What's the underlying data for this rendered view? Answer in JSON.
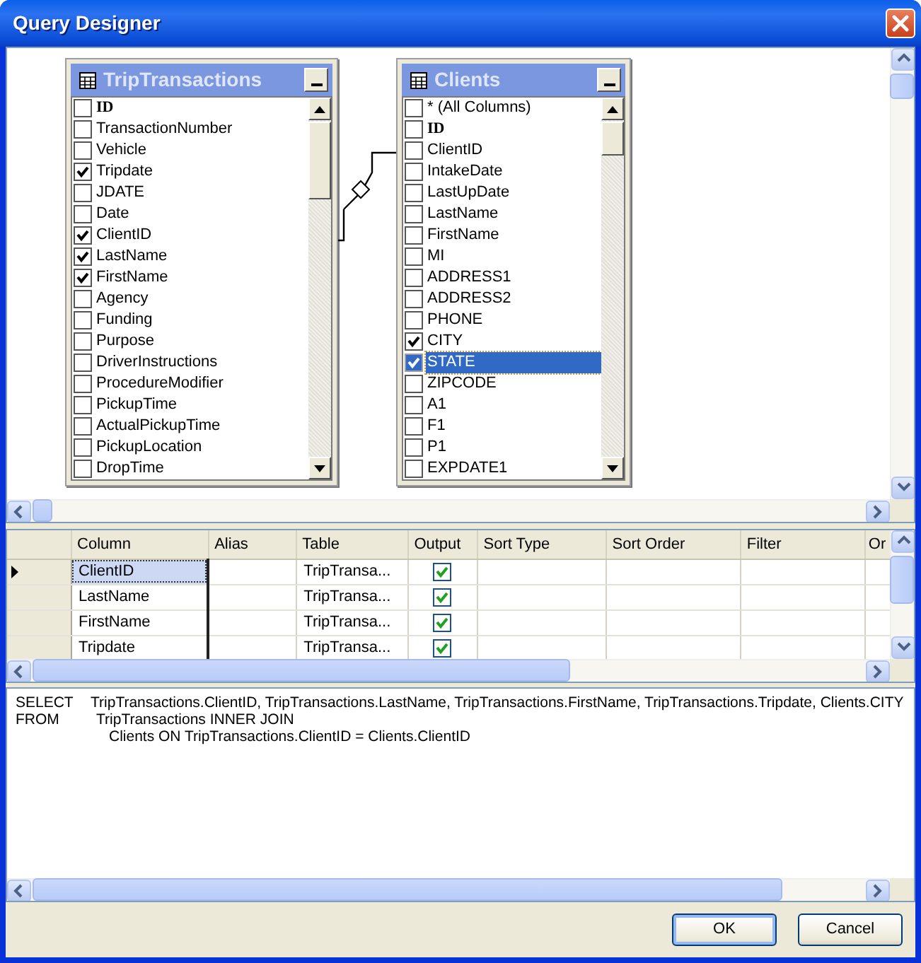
{
  "window": {
    "title": "Query Designer"
  },
  "diagram": {
    "tables": [
      {
        "title": "TripTransactions",
        "items": [
          {
            "label": "ID",
            "kind": "key",
            "checked": false,
            "selected": false
          },
          {
            "label": "TransactionNumber",
            "kind": "column",
            "checked": false,
            "selected": false
          },
          {
            "label": "Vehicle",
            "kind": "column",
            "checked": false,
            "selected": false
          },
          {
            "label": "Tripdate",
            "kind": "column",
            "checked": true,
            "selected": false
          },
          {
            "label": "JDATE",
            "kind": "column",
            "checked": false,
            "selected": false
          },
          {
            "label": "Date",
            "kind": "column",
            "checked": false,
            "selected": false
          },
          {
            "label": "ClientID",
            "kind": "column",
            "checked": true,
            "selected": false
          },
          {
            "label": "LastName",
            "kind": "column",
            "checked": true,
            "selected": false
          },
          {
            "label": "FirstName",
            "kind": "column",
            "checked": true,
            "selected": false
          },
          {
            "label": "Agency",
            "kind": "column",
            "checked": false,
            "selected": false
          },
          {
            "label": "Funding",
            "kind": "column",
            "checked": false,
            "selected": false
          },
          {
            "label": "Purpose",
            "kind": "column",
            "checked": false,
            "selected": false
          },
          {
            "label": "DriverInstructions",
            "kind": "column",
            "checked": false,
            "selected": false
          },
          {
            "label": "ProcedureModifier",
            "kind": "column",
            "checked": false,
            "selected": false
          },
          {
            "label": "PickupTime",
            "kind": "column",
            "checked": false,
            "selected": false
          },
          {
            "label": "ActualPickupTime",
            "kind": "column",
            "checked": false,
            "selected": false
          },
          {
            "label": "PickupLocation",
            "kind": "column",
            "checked": false,
            "selected": false
          },
          {
            "label": "DropTime",
            "kind": "column",
            "checked": false,
            "selected": false
          }
        ]
      },
      {
        "title": "Clients",
        "items": [
          {
            "label": "* (All Columns)",
            "kind": "column",
            "checked": false,
            "selected": false
          },
          {
            "label": "ID",
            "kind": "key",
            "checked": false,
            "selected": false
          },
          {
            "label": "ClientID",
            "kind": "column",
            "checked": false,
            "selected": false
          },
          {
            "label": "IntakeDate",
            "kind": "column",
            "checked": false,
            "selected": false
          },
          {
            "label": "LastUpDate",
            "kind": "column",
            "checked": false,
            "selected": false
          },
          {
            "label": "LastName",
            "kind": "column",
            "checked": false,
            "selected": false
          },
          {
            "label": "FirstName",
            "kind": "column",
            "checked": false,
            "selected": false
          },
          {
            "label": "MI",
            "kind": "column",
            "checked": false,
            "selected": false
          },
          {
            "label": "ADDRESS1",
            "kind": "column",
            "checked": false,
            "selected": false
          },
          {
            "label": "ADDRESS2",
            "kind": "column",
            "checked": false,
            "selected": false
          },
          {
            "label": "PHONE",
            "kind": "column",
            "checked": false,
            "selected": false
          },
          {
            "label": "CITY",
            "kind": "column",
            "checked": true,
            "selected": false
          },
          {
            "label": "STATE",
            "kind": "column",
            "checked": true,
            "selected": true
          },
          {
            "label": "ZIPCODE",
            "kind": "column",
            "checked": false,
            "selected": false
          },
          {
            "label": "A1",
            "kind": "column",
            "checked": false,
            "selected": false
          },
          {
            "label": "F1",
            "kind": "column",
            "checked": false,
            "selected": false
          },
          {
            "label": "P1",
            "kind": "column",
            "checked": false,
            "selected": false
          },
          {
            "label": "EXPDATE1",
            "kind": "column",
            "checked": false,
            "selected": false
          }
        ]
      }
    ]
  },
  "grid": {
    "columns": [
      "Column",
      "Alias",
      "Table",
      "Output",
      "Sort Type",
      "Sort Order",
      "Filter",
      "Or"
    ],
    "rows": [
      {
        "column": "ClientID",
        "table": "TripTransa...",
        "output": true,
        "selected": true
      },
      {
        "column": "LastName",
        "table": "TripTransa...",
        "output": true,
        "selected": false
      },
      {
        "column": "FirstName",
        "table": "TripTransa...",
        "output": true,
        "selected": false
      },
      {
        "column": "Tripdate",
        "table": "TripTransa...",
        "output": true,
        "selected": false
      }
    ]
  },
  "sql": {
    "lines": [
      {
        "kind": "clause",
        "keyword": "SELECT",
        "text": "TripTransactions.ClientID, TripTransactions.LastName, TripTransactions.FirstName, TripTransactions.Tripdate, Clients.CITY"
      },
      {
        "kind": "clause",
        "keyword": "FROM",
        "text": "TripTransactions INNER JOIN"
      },
      {
        "kind": "continuation",
        "text": "Clients ON TripTransactions.ClientID = Clients.ClientID"
      }
    ]
  },
  "buttons": [
    {
      "label": "OK",
      "default": true
    },
    {
      "label": "Cancel",
      "default": false
    }
  ]
}
